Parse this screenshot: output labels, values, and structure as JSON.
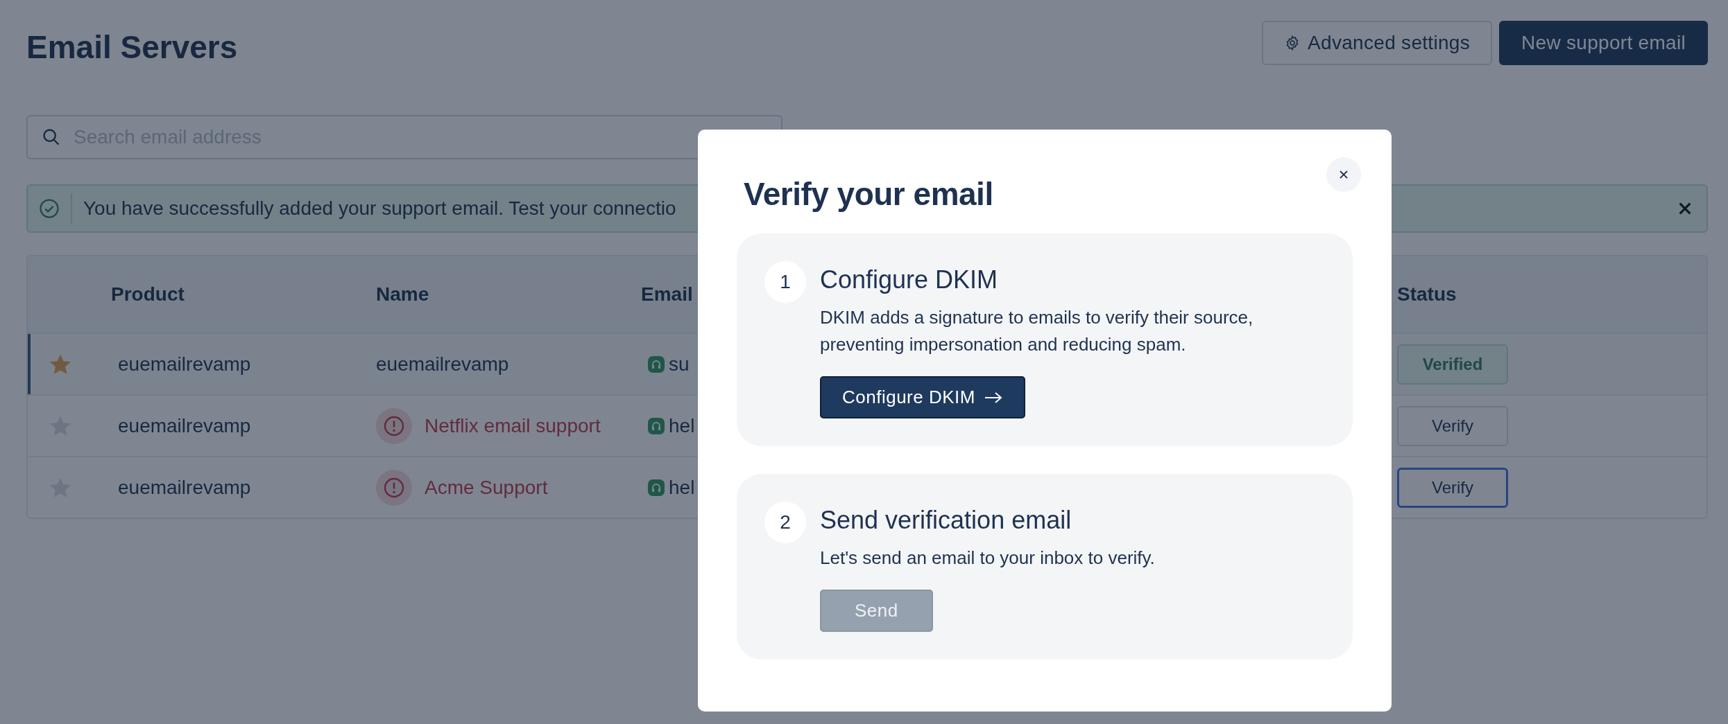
{
  "page": {
    "title": "Email Servers",
    "actions": [
      {
        "label": "Advanced settings",
        "kind": "secondary"
      },
      {
        "label": "New support email",
        "kind": "primary"
      }
    ],
    "search": {
      "placeholder": "Search email address"
    },
    "alert": {
      "message": "You have successfully added your support email. Test your connectio"
    },
    "table": {
      "columns": [
        "Product",
        "Name",
        "Email",
        "Status"
      ],
      "rows": [
        {
          "starred": true,
          "selected": true,
          "product": "euemailrevamp",
          "name": "euemailrevamp",
          "warning": false,
          "email": "su",
          "status": {
            "label": "Verified",
            "kind": "verified",
            "focused": false
          }
        },
        {
          "starred": false,
          "selected": false,
          "product": "euemailrevamp",
          "name": "Netflix email support",
          "warning": true,
          "email": "hel",
          "status": {
            "label": "Verify",
            "kind": "action",
            "focused": false
          }
        },
        {
          "starred": false,
          "selected": false,
          "product": "euemailrevamp",
          "name": "Acme Support",
          "warning": true,
          "email": "hel",
          "status": {
            "label": "Verify",
            "kind": "action",
            "focused": true
          }
        }
      ]
    }
  },
  "modal": {
    "title": "Verify your email",
    "steps": [
      {
        "number": "1",
        "title": "Configure DKIM",
        "description": "DKIM adds a signature to emails to verify their source, preventing impersonation and reducing spam.",
        "button": {
          "label": "Configure DKIM",
          "arrow": true,
          "disabled": false
        }
      },
      {
        "number": "2",
        "title": "Send verification email",
        "description": "Let's send an email to your inbox to verify.",
        "button": {
          "label": "Send",
          "arrow": false,
          "disabled": true
        }
      }
    ]
  }
}
